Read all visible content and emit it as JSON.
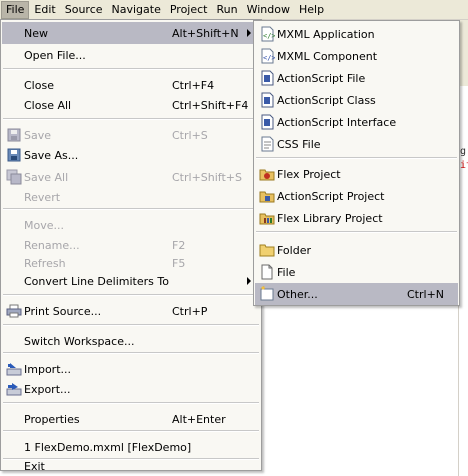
{
  "menubar": {
    "items": [
      "File",
      "Edit",
      "Source",
      "Navigate",
      "Project",
      "Run",
      "Window",
      "Help"
    ]
  },
  "file_menu": {
    "new": {
      "label": "New",
      "accel": "Alt+Shift+N"
    },
    "open_file": {
      "label": "Open File..."
    },
    "close": {
      "label": "Close",
      "accel": "Ctrl+F4"
    },
    "close_all": {
      "label": "Close All",
      "accel": "Ctrl+Shift+F4"
    },
    "save": {
      "label": "Save",
      "accel": "Ctrl+S"
    },
    "save_as": {
      "label": "Save As..."
    },
    "save_all": {
      "label": "Save All",
      "accel": "Ctrl+Shift+S"
    },
    "revert": {
      "label": "Revert"
    },
    "move": {
      "label": "Move..."
    },
    "rename": {
      "label": "Rename...",
      "accel": "F2"
    },
    "refresh": {
      "label": "Refresh",
      "accel": "F5"
    },
    "convert": {
      "label": "Convert Line Delimiters To"
    },
    "print": {
      "label": "Print Source...",
      "accel": "Ctrl+P"
    },
    "switch": {
      "label": "Switch Workspace..."
    },
    "import": {
      "label": "Import..."
    },
    "export": {
      "label": "Export..."
    },
    "properties": {
      "label": "Properties",
      "accel": "Alt+Enter"
    },
    "recent": {
      "label": "1 FlexDemo.mxml  [FlexDemo]"
    },
    "exit": {
      "label": "Exit"
    }
  },
  "new_menu": {
    "mxml_app": {
      "label": "MXML Application"
    },
    "mxml_comp": {
      "label": "MXML Component"
    },
    "as_file": {
      "label": "ActionScript File"
    },
    "as_class": {
      "label": "ActionScript Class"
    },
    "as_iface": {
      "label": "ActionScript Interface"
    },
    "css_file": {
      "label": "CSS File"
    },
    "flex_project": {
      "label": "Flex Project"
    },
    "as_project": {
      "label": "ActionScript Project"
    },
    "flex_lib": {
      "label": "Flex Library Project"
    },
    "folder": {
      "label": "Folder"
    },
    "file": {
      "label": "File"
    },
    "other": {
      "label": "Other...",
      "accel": "Ctrl+N"
    }
  },
  "editor": {
    "c1": "g",
    "c2": "it"
  },
  "colors": {
    "highlight": "#b9b9c4",
    "menu_bg": "#f9f8f3",
    "disabled": "#a7a6aa"
  }
}
